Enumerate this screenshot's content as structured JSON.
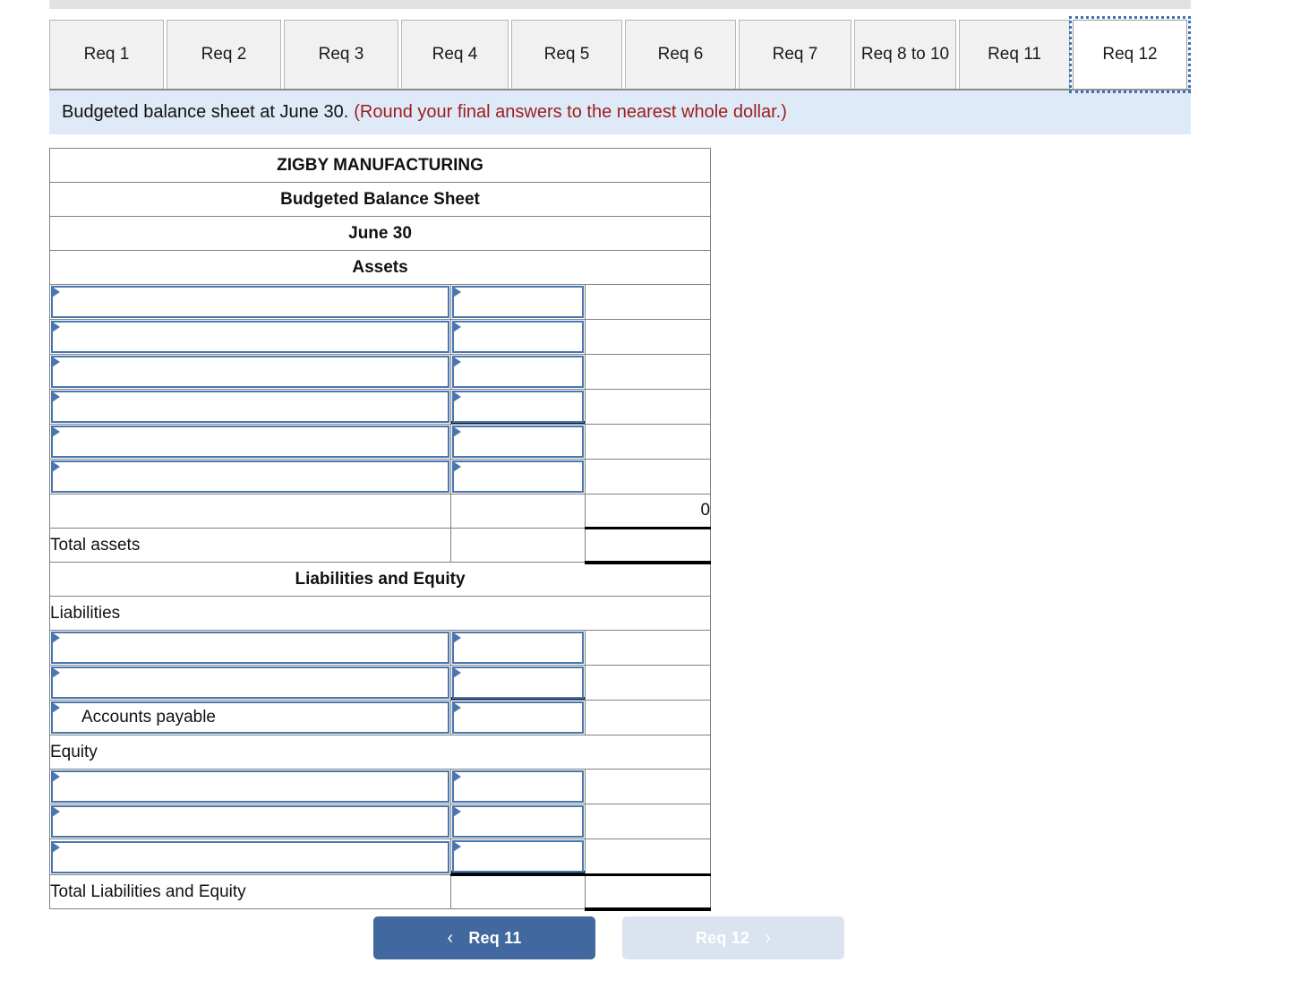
{
  "tabs": [
    {
      "label": "Req 1",
      "selected": false
    },
    {
      "label": "Req 2",
      "selected": false
    },
    {
      "label": "Req 3",
      "selected": false
    },
    {
      "label": "Req 4",
      "selected": false
    },
    {
      "label": "Req 5",
      "selected": false
    },
    {
      "label": "Req 6",
      "selected": false
    },
    {
      "label": "Req 7",
      "selected": false
    },
    {
      "label": "Req 8 to 10",
      "selected": false
    },
    {
      "label": "Req 11",
      "selected": false
    },
    {
      "label": "Req 12",
      "selected": true
    }
  ],
  "instruction": {
    "text": "Budgeted balance sheet at June 30.",
    "note": "(Round your final answers to the nearest whole dollar.)"
  },
  "sheet": {
    "company": "ZIGBY MANUFACTURING",
    "title": "Budgeted Balance Sheet",
    "date": "June 30",
    "assets_header": "Assets",
    "asset_rows": [
      {
        "label": "",
        "amount": ""
      },
      {
        "label": "",
        "amount": ""
      },
      {
        "label": "",
        "amount": ""
      },
      {
        "label": "",
        "amount": ""
      },
      {
        "label": "",
        "amount": ""
      },
      {
        "label": "",
        "amount": ""
      }
    ],
    "assets_subtotal": "0",
    "total_assets_label": "Total assets",
    "total_assets_value": "",
    "liab_equity_header": "Liabilities and Equity",
    "liabilities_label": "Liabilities",
    "liability_rows": [
      {
        "label": "",
        "amount": ""
      },
      {
        "label": "",
        "amount": ""
      },
      {
        "label": "Accounts payable",
        "amount": ""
      }
    ],
    "equity_label": "Equity",
    "equity_rows": [
      {
        "label": "",
        "amount": ""
      },
      {
        "label": "",
        "amount": ""
      },
      {
        "label": "",
        "amount": ""
      }
    ],
    "total_le_label": "Total Liabilities and Equity",
    "total_le_value": ""
  },
  "nav": {
    "prev_label": "Req 11",
    "prev_icon": "chevron-left-icon",
    "next_label": "Req 12",
    "next_icon": "chevron-right-icon"
  },
  "colors": {
    "header_blue": "#80a8df",
    "banner_blue": "#deeaf7",
    "note_red": "#9e1c1c",
    "input_border": "#4a76b0",
    "prev_button": "#41689f",
    "next_button": "#dbe4ee"
  }
}
